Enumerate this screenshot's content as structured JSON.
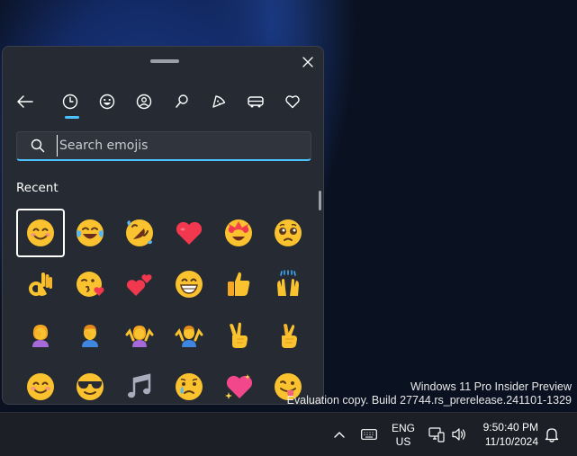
{
  "panel": {
    "tabs": [
      {
        "name": "back",
        "icon": "back-arrow-icon"
      },
      {
        "name": "recent",
        "icon": "clock-icon",
        "active": true
      },
      {
        "name": "smileys",
        "icon": "smiley-icon"
      },
      {
        "name": "people",
        "icon": "people-icon"
      },
      {
        "name": "nature",
        "icon": "leaf-icon"
      },
      {
        "name": "food",
        "icon": "pizza-icon"
      },
      {
        "name": "travel",
        "icon": "bus-icon"
      },
      {
        "name": "symbols",
        "icon": "heart-icon"
      }
    ],
    "search": {
      "placeholder": "Search emojis",
      "value": ""
    },
    "section_title": "Recent",
    "emojis": [
      "smiling-face-with-smiling-eyes",
      "face-with-tears-of-joy",
      "rolling-on-the-floor-laughing",
      "red-heart",
      "star-struck",
      "pleading-face",
      "ok-hand",
      "face-blowing-a-kiss",
      "two-hearts",
      "grinning-face",
      "thumbs-up",
      "raising-hands",
      "woman-facepalming",
      "man-facepalming",
      "woman-shrugging",
      "man-shrugging",
      "victory-hand",
      "crossed-fingers",
      "smiling-face",
      "smiling-face-with-sunglasses",
      "musical-notes",
      "crying-face",
      "sparkling-heart",
      "face-with-tongue"
    ]
  },
  "watermark": {
    "line1": "Windows 11 Pro Insider Preview",
    "line2": "Evaluation copy. Build 27744.rs_prerelease.241101-1329"
  },
  "taskbar": {
    "lang_line1": "ENG",
    "lang_line2": "US",
    "time": "9:50:40 PM",
    "date": "11/10/2024"
  },
  "colors": {
    "accent": "#4cc2ff",
    "panel_bg": "#252a33",
    "taskbar_bg": "#1c1f26",
    "emoji_yellow": "#f9c22e"
  }
}
